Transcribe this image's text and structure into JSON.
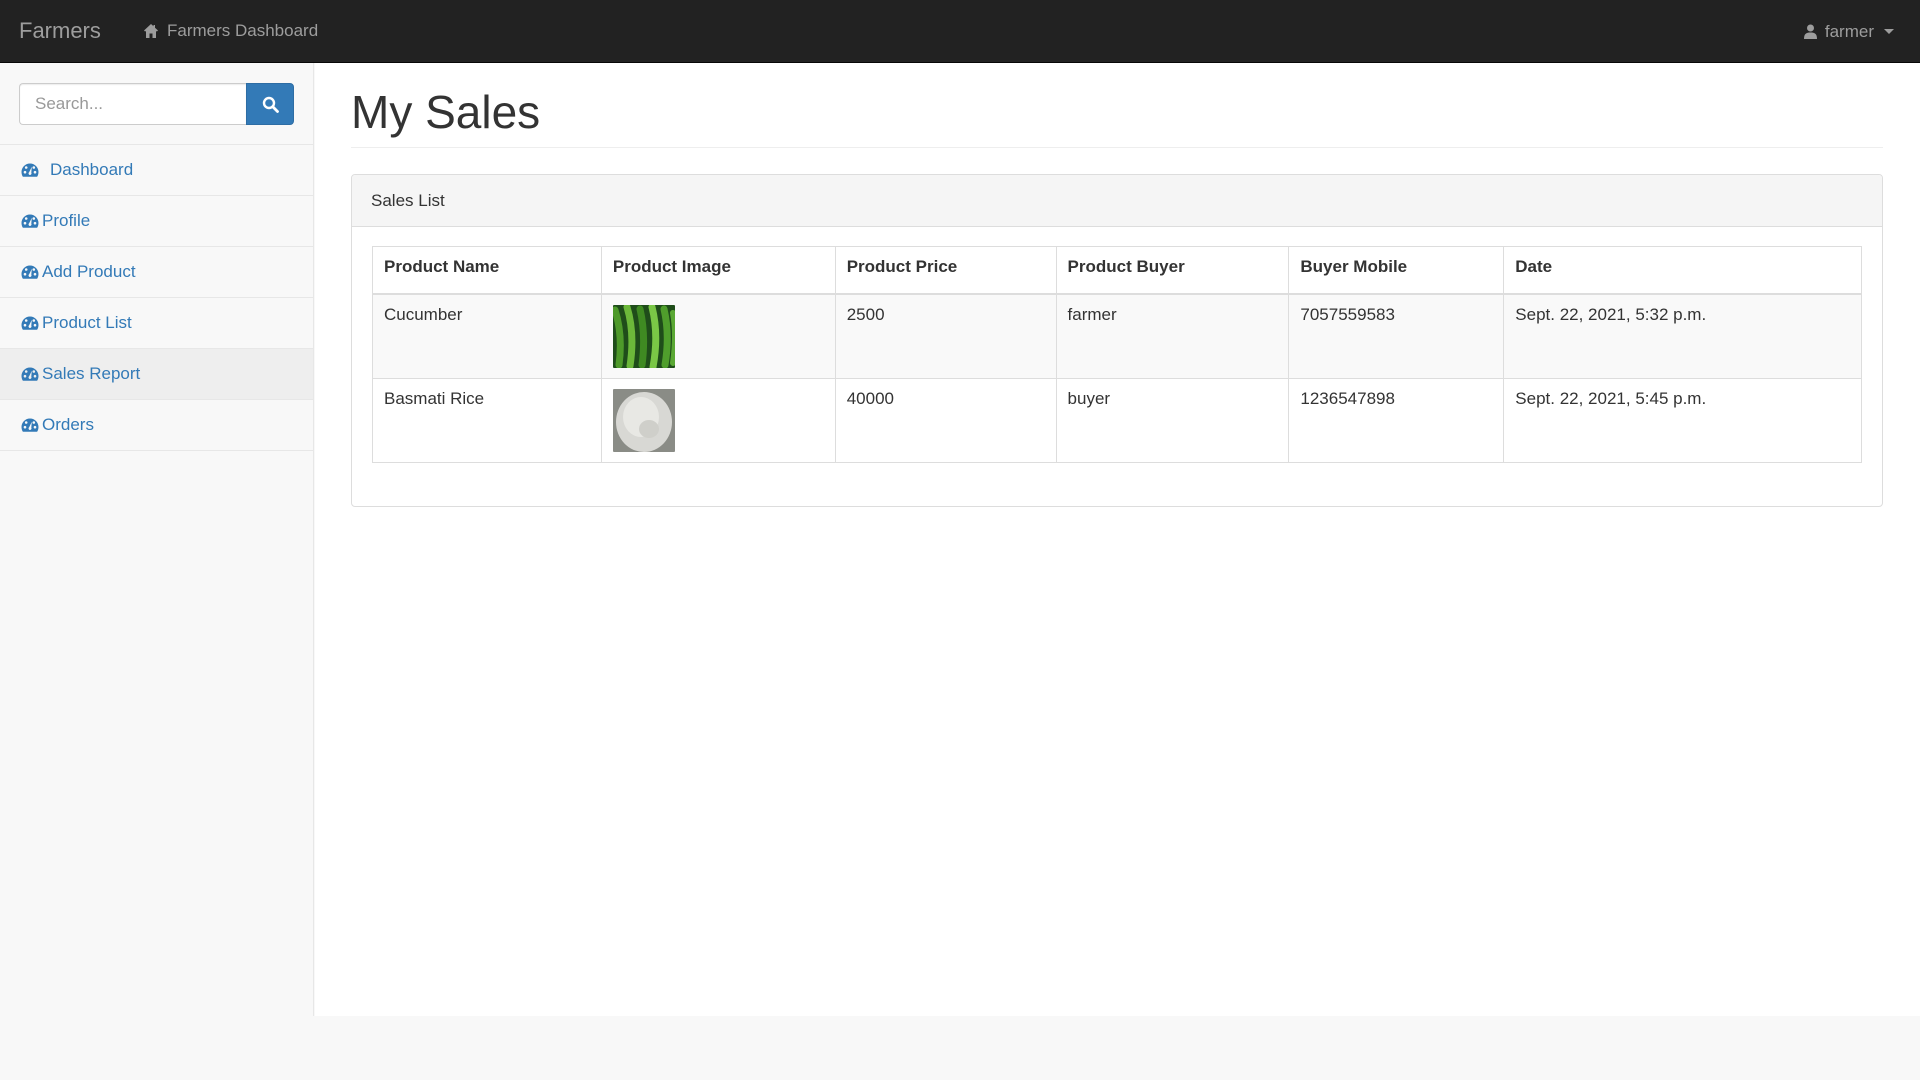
{
  "navbar": {
    "brand": "Farmers",
    "dashboard_link": "Farmers Dashboard",
    "user": "farmer"
  },
  "sidebar": {
    "search_placeholder": "Search...",
    "items": [
      {
        "label": "Dashboard",
        "icon": "dashboard-icon",
        "active": false
      },
      {
        "label": "Profile",
        "icon": "dashboard-icon",
        "active": false
      },
      {
        "label": "Add Product",
        "icon": "dashboard-icon",
        "active": false
      },
      {
        "label": "Product List",
        "icon": "dashboard-icon",
        "active": false
      },
      {
        "label": "Sales Report",
        "icon": "dashboard-icon",
        "active": true
      },
      {
        "label": "Orders",
        "icon": "dashboard-icon",
        "active": false
      }
    ]
  },
  "main": {
    "title": "My Sales",
    "panel_heading": "Sales List",
    "table": {
      "headers": [
        "Product Name",
        "Product Image",
        "Product Price",
        "Product Buyer",
        "Buyer Mobile",
        "Date"
      ],
      "rows": [
        {
          "name": "Cucumber",
          "image": "cucumber-image",
          "price": "2500",
          "buyer": "farmer",
          "mobile": "7057559583",
          "date": "Sept. 22, 2021, 5:32 p.m."
        },
        {
          "name": "Basmati Rice",
          "image": "rice-image",
          "price": "40000",
          "buyer": "buyer",
          "mobile": "1236547898",
          "date": "Sept. 22, 2021, 5:45 p.m."
        }
      ]
    }
  },
  "colors": {
    "navbar_bg": "#222222",
    "link": "#337ab7",
    "search_button": "#337ab7"
  }
}
